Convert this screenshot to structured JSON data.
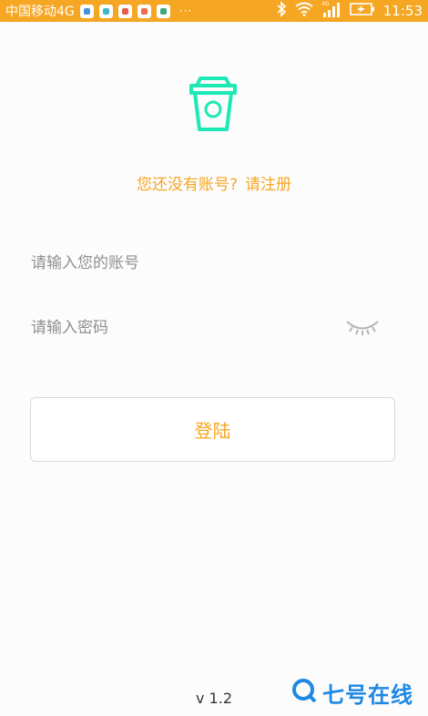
{
  "status_bar": {
    "carrier": "中国移动4G",
    "more": "···",
    "network_badge": "4G",
    "time": "11:53",
    "colors": {
      "background": "#f5a623",
      "foreground": "#ffffff"
    },
    "icons": [
      "notification-app-icon",
      "bluetooth-icon",
      "wifi-icon",
      "signal-icon",
      "battery-charging-icon"
    ]
  },
  "login": {
    "register_prompt": "您还没有账号?",
    "register_link": "请注册",
    "account_placeholder": "请输入您的账号",
    "password_placeholder": "请输入密码",
    "login_button": "登陆"
  },
  "footer": {
    "version": "v 1.2"
  },
  "watermark": {
    "text": "七号在线"
  },
  "colors": {
    "accent": "#f5a623",
    "logo": "#1de9b6",
    "watermark": "#1e88e5"
  }
}
